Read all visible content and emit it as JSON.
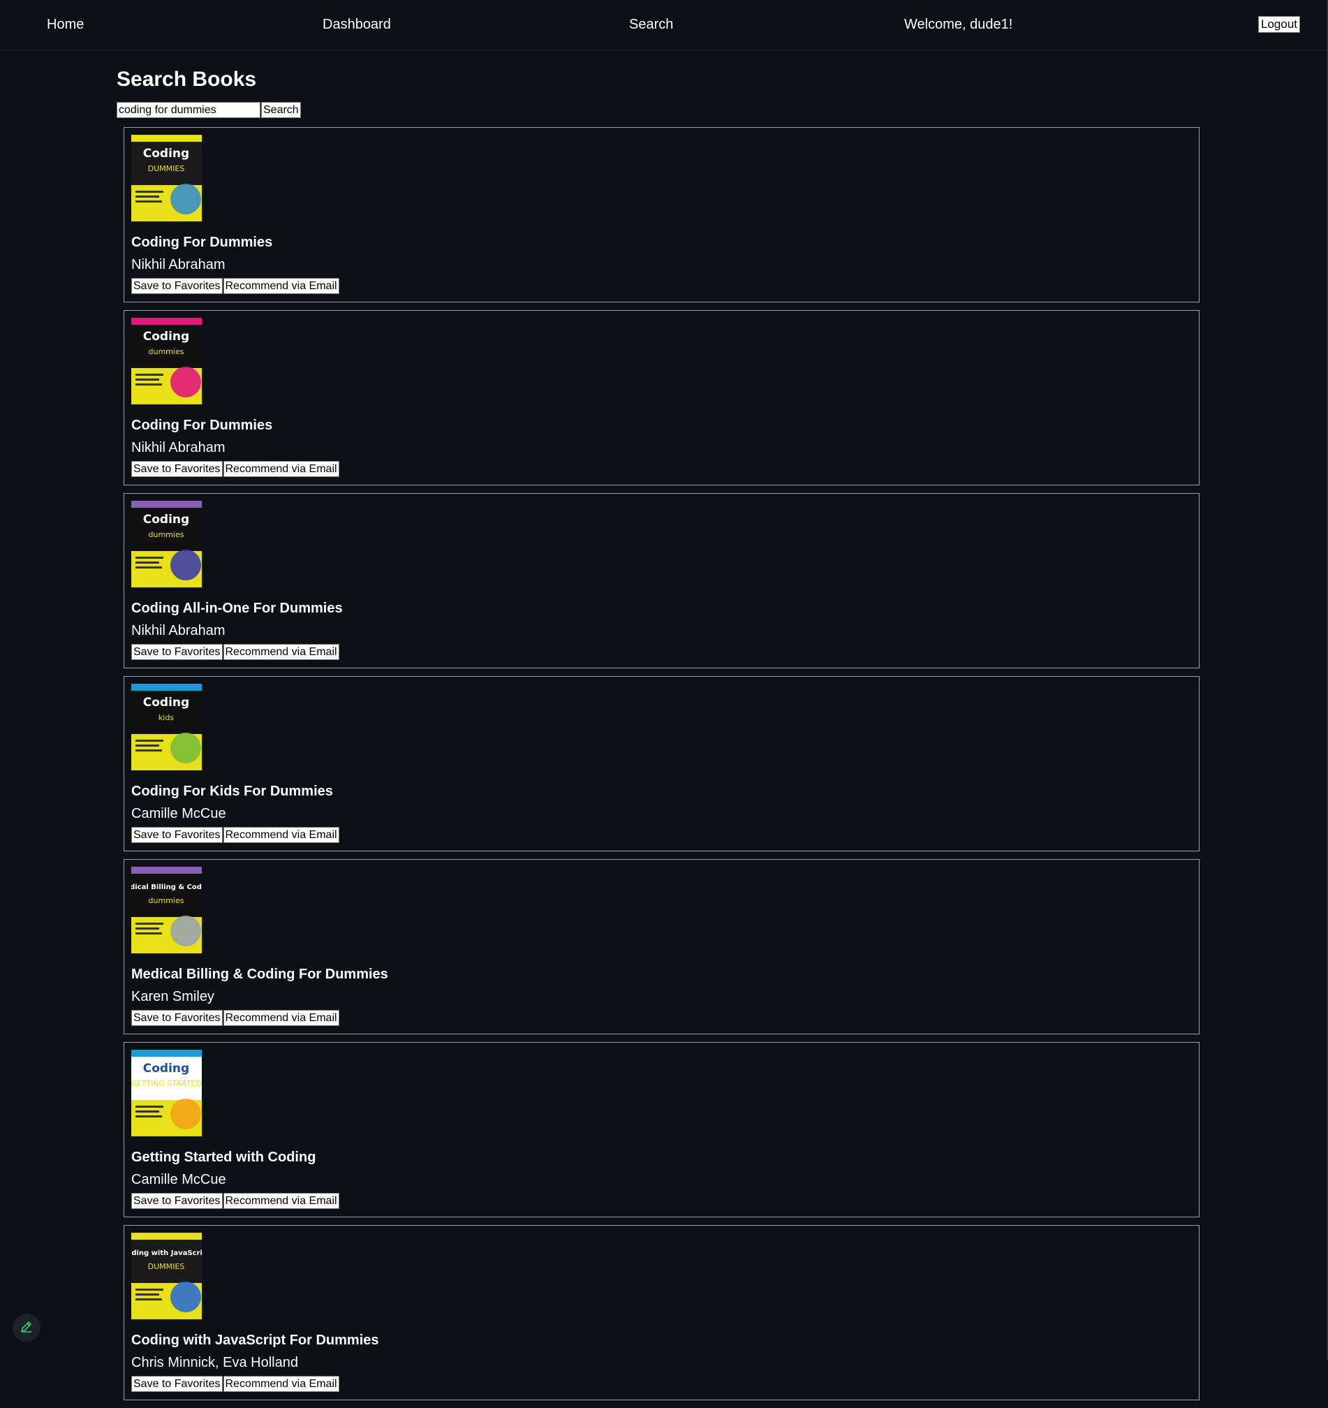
{
  "nav": {
    "home": "Home",
    "dashboard": "Dashboard",
    "search": "Search",
    "welcome": "Welcome, dude1!",
    "logout": "Logout"
  },
  "page": {
    "title": "Search Books"
  },
  "search": {
    "value": "coding for dummies",
    "button": "Search"
  },
  "labels": {
    "save": "Save to Favorites",
    "recommend": "Recommend via Email"
  },
  "books": [
    {
      "title": "Coding For Dummies",
      "author": "Nikhil Abraham",
      "cover": {
        "top": "#e8e01a",
        "band": "#1a1a1a",
        "accent": "#3a8fc9",
        "text": "Coding",
        "sub": "DUMMIES"
      }
    },
    {
      "title": "Coding For Dummies",
      "author": "Nikhil Abraham",
      "cover": {
        "top": "#e3197b",
        "band": "#111111",
        "accent": "#e3197b",
        "text": "Coding",
        "sub": "dummies"
      }
    },
    {
      "title": "Coding All-in-One For Dummies",
      "author": "Nikhil Abraham",
      "cover": {
        "top": "#8a5fb5",
        "band": "#111111",
        "accent": "#3c3fa8",
        "text": "Coding",
        "sub": "dummies"
      }
    },
    {
      "title": "Coding For Kids For Dummies",
      "author": "Camille McCue",
      "cover": {
        "top": "#1a9ad6",
        "band": "#111111",
        "accent": "#7bbf3a",
        "text": "Coding",
        "sub": "kids"
      }
    },
    {
      "title": "Medical Billing & Coding For Dummies",
      "author": "Karen Smiley",
      "cover": {
        "top": "#8a5fb5",
        "band": "#111111",
        "accent": "#9aa3ad",
        "text": "Medical Billing & Coding",
        "sub": "dummies"
      }
    },
    {
      "title": "Getting Started with Coding",
      "author": "Camille McCue",
      "cover": {
        "top": "#1a9ad6",
        "band": "#ffffff",
        "accent": "#f2a51a",
        "text": "Coding",
        "sub": "GETTING STARTED"
      }
    },
    {
      "title": "Coding with JavaScript For Dummies",
      "author": "Chris Minnick, Eva Holland",
      "cover": {
        "top": "#e8e01a",
        "band": "#1a1a1a",
        "accent": "#2f6fd1",
        "text": "Coding with JavaScript",
        "sub": "DUMMIES"
      }
    }
  ]
}
